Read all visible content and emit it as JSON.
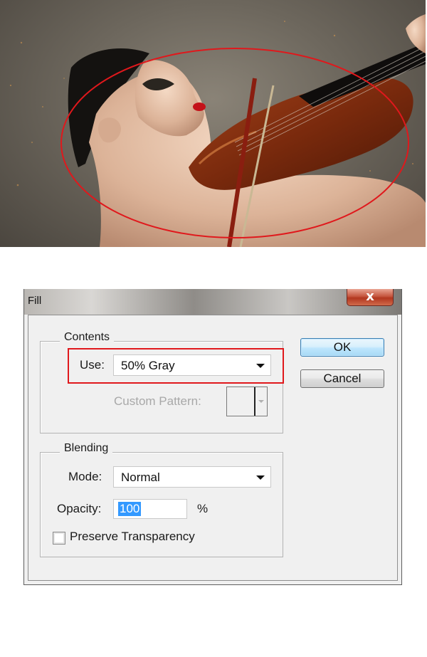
{
  "dialog": {
    "title": "Fill",
    "close_glyph": "x",
    "contents": {
      "legend": "Contents",
      "use_label": "Use:",
      "use_value": "50% Gray",
      "custom_pattern_label": "Custom Pattern:"
    },
    "blending": {
      "legend": "Blending",
      "mode_label": "Mode:",
      "mode_value": "Normal",
      "opacity_label": "Opacity:",
      "opacity_value": "100",
      "opacity_unit": "%",
      "preserve_label": "Preserve Transparency",
      "preserve_checked": false
    },
    "buttons": {
      "ok": "OK",
      "cancel": "Cancel"
    }
  },
  "icons": [
    "close-icon",
    "dropdown-arrow-icon",
    "pattern-dropdown-arrow-icon"
  ],
  "colors": {
    "annotation_red": "#e0181c",
    "selection_blue": "#3399ff",
    "ok_border": "#3c7fb1"
  }
}
